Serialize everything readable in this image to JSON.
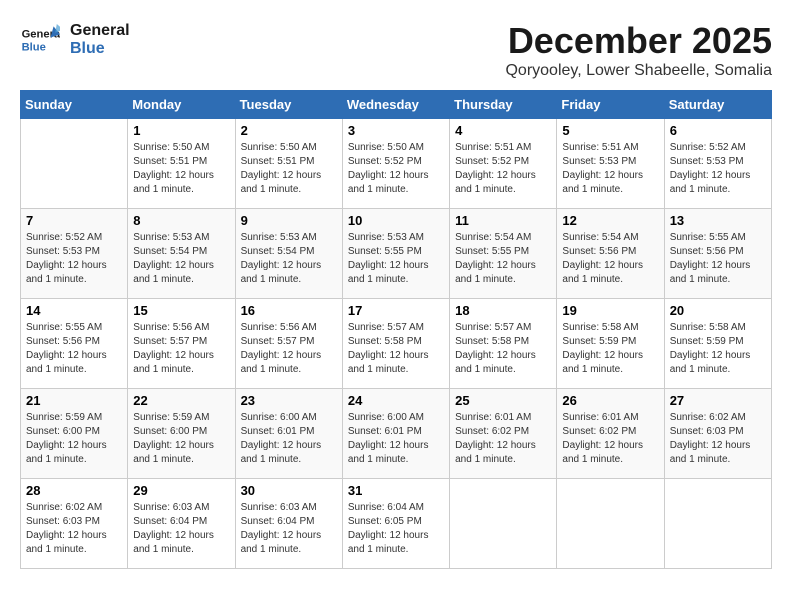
{
  "logo": {
    "line1": "General",
    "line2": "Blue"
  },
  "title": "December 2025",
  "subtitle": "Qoryooley, Lower Shabeelle, Somalia",
  "days_of_week": [
    "Sunday",
    "Monday",
    "Tuesday",
    "Wednesday",
    "Thursday",
    "Friday",
    "Saturday"
  ],
  "weeks": [
    [
      {
        "day": "",
        "sunrise": "",
        "sunset": "",
        "daylight": ""
      },
      {
        "day": "1",
        "sunrise": "Sunrise: 5:50 AM",
        "sunset": "Sunset: 5:51 PM",
        "daylight": "Daylight: 12 hours and 1 minute."
      },
      {
        "day": "2",
        "sunrise": "Sunrise: 5:50 AM",
        "sunset": "Sunset: 5:51 PM",
        "daylight": "Daylight: 12 hours and 1 minute."
      },
      {
        "day": "3",
        "sunrise": "Sunrise: 5:50 AM",
        "sunset": "Sunset: 5:52 PM",
        "daylight": "Daylight: 12 hours and 1 minute."
      },
      {
        "day": "4",
        "sunrise": "Sunrise: 5:51 AM",
        "sunset": "Sunset: 5:52 PM",
        "daylight": "Daylight: 12 hours and 1 minute."
      },
      {
        "day": "5",
        "sunrise": "Sunrise: 5:51 AM",
        "sunset": "Sunset: 5:53 PM",
        "daylight": "Daylight: 12 hours and 1 minute."
      },
      {
        "day": "6",
        "sunrise": "Sunrise: 5:52 AM",
        "sunset": "Sunset: 5:53 PM",
        "daylight": "Daylight: 12 hours and 1 minute."
      }
    ],
    [
      {
        "day": "7",
        "sunrise": "Sunrise: 5:52 AM",
        "sunset": "Sunset: 5:53 PM",
        "daylight": "Daylight: 12 hours and 1 minute."
      },
      {
        "day": "8",
        "sunrise": "Sunrise: 5:53 AM",
        "sunset": "Sunset: 5:54 PM",
        "daylight": "Daylight: 12 hours and 1 minute."
      },
      {
        "day": "9",
        "sunrise": "Sunrise: 5:53 AM",
        "sunset": "Sunset: 5:54 PM",
        "daylight": "Daylight: 12 hours and 1 minute."
      },
      {
        "day": "10",
        "sunrise": "Sunrise: 5:53 AM",
        "sunset": "Sunset: 5:55 PM",
        "daylight": "Daylight: 12 hours and 1 minute."
      },
      {
        "day": "11",
        "sunrise": "Sunrise: 5:54 AM",
        "sunset": "Sunset: 5:55 PM",
        "daylight": "Daylight: 12 hours and 1 minute."
      },
      {
        "day": "12",
        "sunrise": "Sunrise: 5:54 AM",
        "sunset": "Sunset: 5:56 PM",
        "daylight": "Daylight: 12 hours and 1 minute."
      },
      {
        "day": "13",
        "sunrise": "Sunrise: 5:55 AM",
        "sunset": "Sunset: 5:56 PM",
        "daylight": "Daylight: 12 hours and 1 minute."
      }
    ],
    [
      {
        "day": "14",
        "sunrise": "Sunrise: 5:55 AM",
        "sunset": "Sunset: 5:56 PM",
        "daylight": "Daylight: 12 hours and 1 minute."
      },
      {
        "day": "15",
        "sunrise": "Sunrise: 5:56 AM",
        "sunset": "Sunset: 5:57 PM",
        "daylight": "Daylight: 12 hours and 1 minute."
      },
      {
        "day": "16",
        "sunrise": "Sunrise: 5:56 AM",
        "sunset": "Sunset: 5:57 PM",
        "daylight": "Daylight: 12 hours and 1 minute."
      },
      {
        "day": "17",
        "sunrise": "Sunrise: 5:57 AM",
        "sunset": "Sunset: 5:58 PM",
        "daylight": "Daylight: 12 hours and 1 minute."
      },
      {
        "day": "18",
        "sunrise": "Sunrise: 5:57 AM",
        "sunset": "Sunset: 5:58 PM",
        "daylight": "Daylight: 12 hours and 1 minute."
      },
      {
        "day": "19",
        "sunrise": "Sunrise: 5:58 AM",
        "sunset": "Sunset: 5:59 PM",
        "daylight": "Daylight: 12 hours and 1 minute."
      },
      {
        "day": "20",
        "sunrise": "Sunrise: 5:58 AM",
        "sunset": "Sunset: 5:59 PM",
        "daylight": "Daylight: 12 hours and 1 minute."
      }
    ],
    [
      {
        "day": "21",
        "sunrise": "Sunrise: 5:59 AM",
        "sunset": "Sunset: 6:00 PM",
        "daylight": "Daylight: 12 hours and 1 minute."
      },
      {
        "day": "22",
        "sunrise": "Sunrise: 5:59 AM",
        "sunset": "Sunset: 6:00 PM",
        "daylight": "Daylight: 12 hours and 1 minute."
      },
      {
        "day": "23",
        "sunrise": "Sunrise: 6:00 AM",
        "sunset": "Sunset: 6:01 PM",
        "daylight": "Daylight: 12 hours and 1 minute."
      },
      {
        "day": "24",
        "sunrise": "Sunrise: 6:00 AM",
        "sunset": "Sunset: 6:01 PM",
        "daylight": "Daylight: 12 hours and 1 minute."
      },
      {
        "day": "25",
        "sunrise": "Sunrise: 6:01 AM",
        "sunset": "Sunset: 6:02 PM",
        "daylight": "Daylight: 12 hours and 1 minute."
      },
      {
        "day": "26",
        "sunrise": "Sunrise: 6:01 AM",
        "sunset": "Sunset: 6:02 PM",
        "daylight": "Daylight: 12 hours and 1 minute."
      },
      {
        "day": "27",
        "sunrise": "Sunrise: 6:02 AM",
        "sunset": "Sunset: 6:03 PM",
        "daylight": "Daylight: 12 hours and 1 minute."
      }
    ],
    [
      {
        "day": "28",
        "sunrise": "Sunrise: 6:02 AM",
        "sunset": "Sunset: 6:03 PM",
        "daylight": "Daylight: 12 hours and 1 minute."
      },
      {
        "day": "29",
        "sunrise": "Sunrise: 6:03 AM",
        "sunset": "Sunset: 6:04 PM",
        "daylight": "Daylight: 12 hours and 1 minute."
      },
      {
        "day": "30",
        "sunrise": "Sunrise: 6:03 AM",
        "sunset": "Sunset: 6:04 PM",
        "daylight": "Daylight: 12 hours and 1 minute."
      },
      {
        "day": "31",
        "sunrise": "Sunrise: 6:04 AM",
        "sunset": "Sunset: 6:05 PM",
        "daylight": "Daylight: 12 hours and 1 minute."
      },
      {
        "day": "",
        "sunrise": "",
        "sunset": "",
        "daylight": ""
      },
      {
        "day": "",
        "sunrise": "",
        "sunset": "",
        "daylight": ""
      },
      {
        "day": "",
        "sunrise": "",
        "sunset": "",
        "daylight": ""
      }
    ]
  ]
}
